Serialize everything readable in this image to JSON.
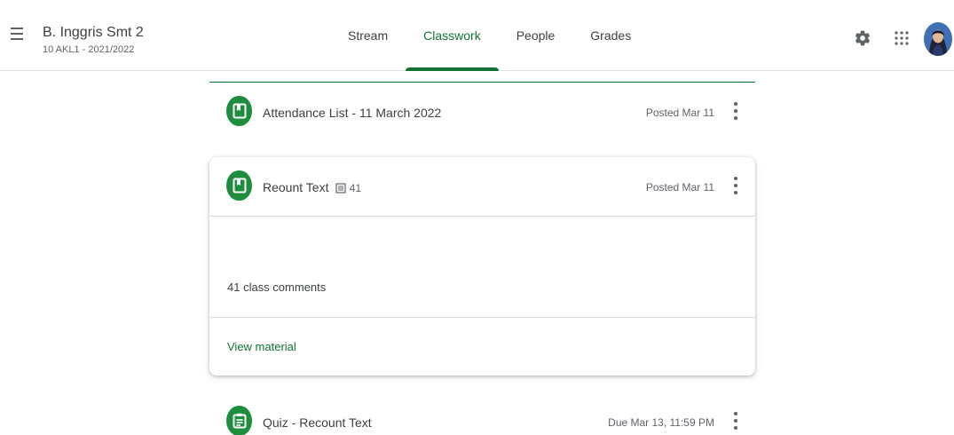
{
  "header": {
    "class_name": "B. Inggris Smt 2",
    "section": "10 AKL1 - 2021/2022",
    "menu_icon": "hamburger-menu-icon",
    "settings_icon": "gear-icon",
    "apps_icon": "google-apps-grid-icon",
    "avatar": "user-avatar"
  },
  "tabs": [
    {
      "label": "Stream",
      "active": false
    },
    {
      "label": "Classwork",
      "active": true
    },
    {
      "label": "People",
      "active": false
    },
    {
      "label": "Grades",
      "active": false
    }
  ],
  "items": [
    {
      "title": "Attendance List - 11 March 2022",
      "date": "Posted Mar 11",
      "icon": "material-icon"
    },
    {
      "title": "Reount Text",
      "comment_count": "41",
      "date": "Posted Mar 11",
      "icon": "material-icon",
      "expanded": true,
      "class_comments": "41 class comments",
      "view_label": "View material"
    },
    {
      "title": "Quiz - Recount Text",
      "date": "Due Mar 13, 11:59 PM",
      "icon": "quiz-assignment-icon"
    }
  ],
  "colors": {
    "accent_green": "#137333",
    "icon_green": "#1e8e3e",
    "text": "#3c4043",
    "muted_text": "#5f6368"
  }
}
